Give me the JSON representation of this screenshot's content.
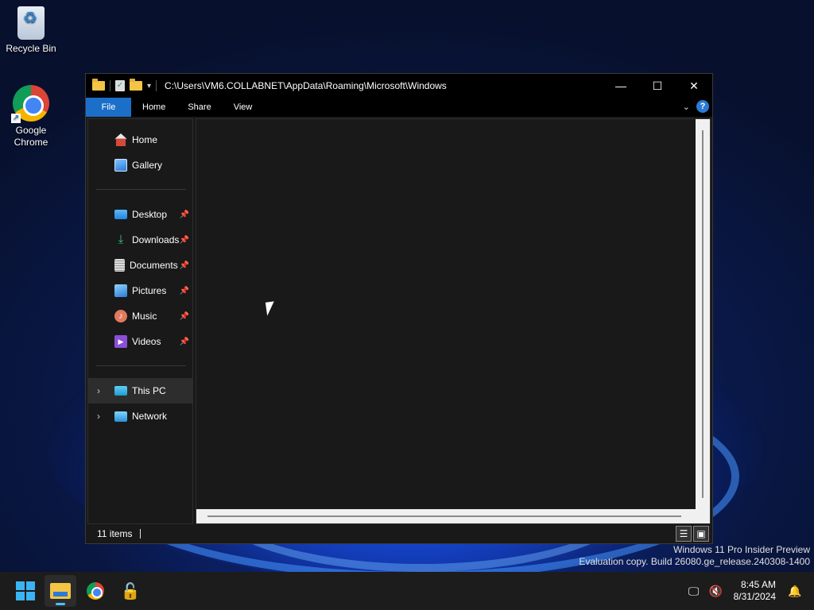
{
  "desktop": {
    "icons": [
      {
        "label": "Recycle Bin",
        "icon": "recycle-bin-icon"
      },
      {
        "label": "Google\nChrome",
        "icon": "chrome-icon"
      }
    ],
    "watermark_line1": "Windows 11 Pro Insider Preview",
    "watermark_line2": "Evaluation copy. Build 26080.ge_release.240308-1400"
  },
  "explorer": {
    "path": "C:\\Users\\VM6.COLLABNET\\AppData\\Roaming\\Microsoft\\Windows",
    "controls": {
      "minimize": "—",
      "maximize": "☐",
      "close": "✕"
    },
    "ribbon_tabs": [
      "File",
      "Home",
      "Share",
      "View"
    ],
    "help": "?",
    "nav": {
      "top": [
        {
          "label": "Home",
          "icon": "home-icon"
        },
        {
          "label": "Gallery",
          "icon": "gallery-icon"
        }
      ],
      "pinned": [
        {
          "label": "Desktop",
          "icon": "desktop-icon"
        },
        {
          "label": "Downloads",
          "icon": "downloads-icon"
        },
        {
          "label": "Documents",
          "icon": "documents-icon"
        },
        {
          "label": "Pictures",
          "icon": "pictures-icon"
        },
        {
          "label": "Music",
          "icon": "music-icon"
        },
        {
          "label": "Videos",
          "icon": "videos-icon"
        }
      ],
      "bottom": [
        {
          "label": "This PC",
          "icon": "this-pc-icon"
        },
        {
          "label": "Network",
          "icon": "network-icon"
        }
      ]
    },
    "status": {
      "items": "11 items"
    }
  },
  "taskbar": {
    "time": "8:45 AM",
    "date": "8/31/2024"
  },
  "colors": {
    "accent": "#1c6fc9",
    "window_bg": "#191919",
    "taskbar_bg": "#1c1c1c"
  }
}
